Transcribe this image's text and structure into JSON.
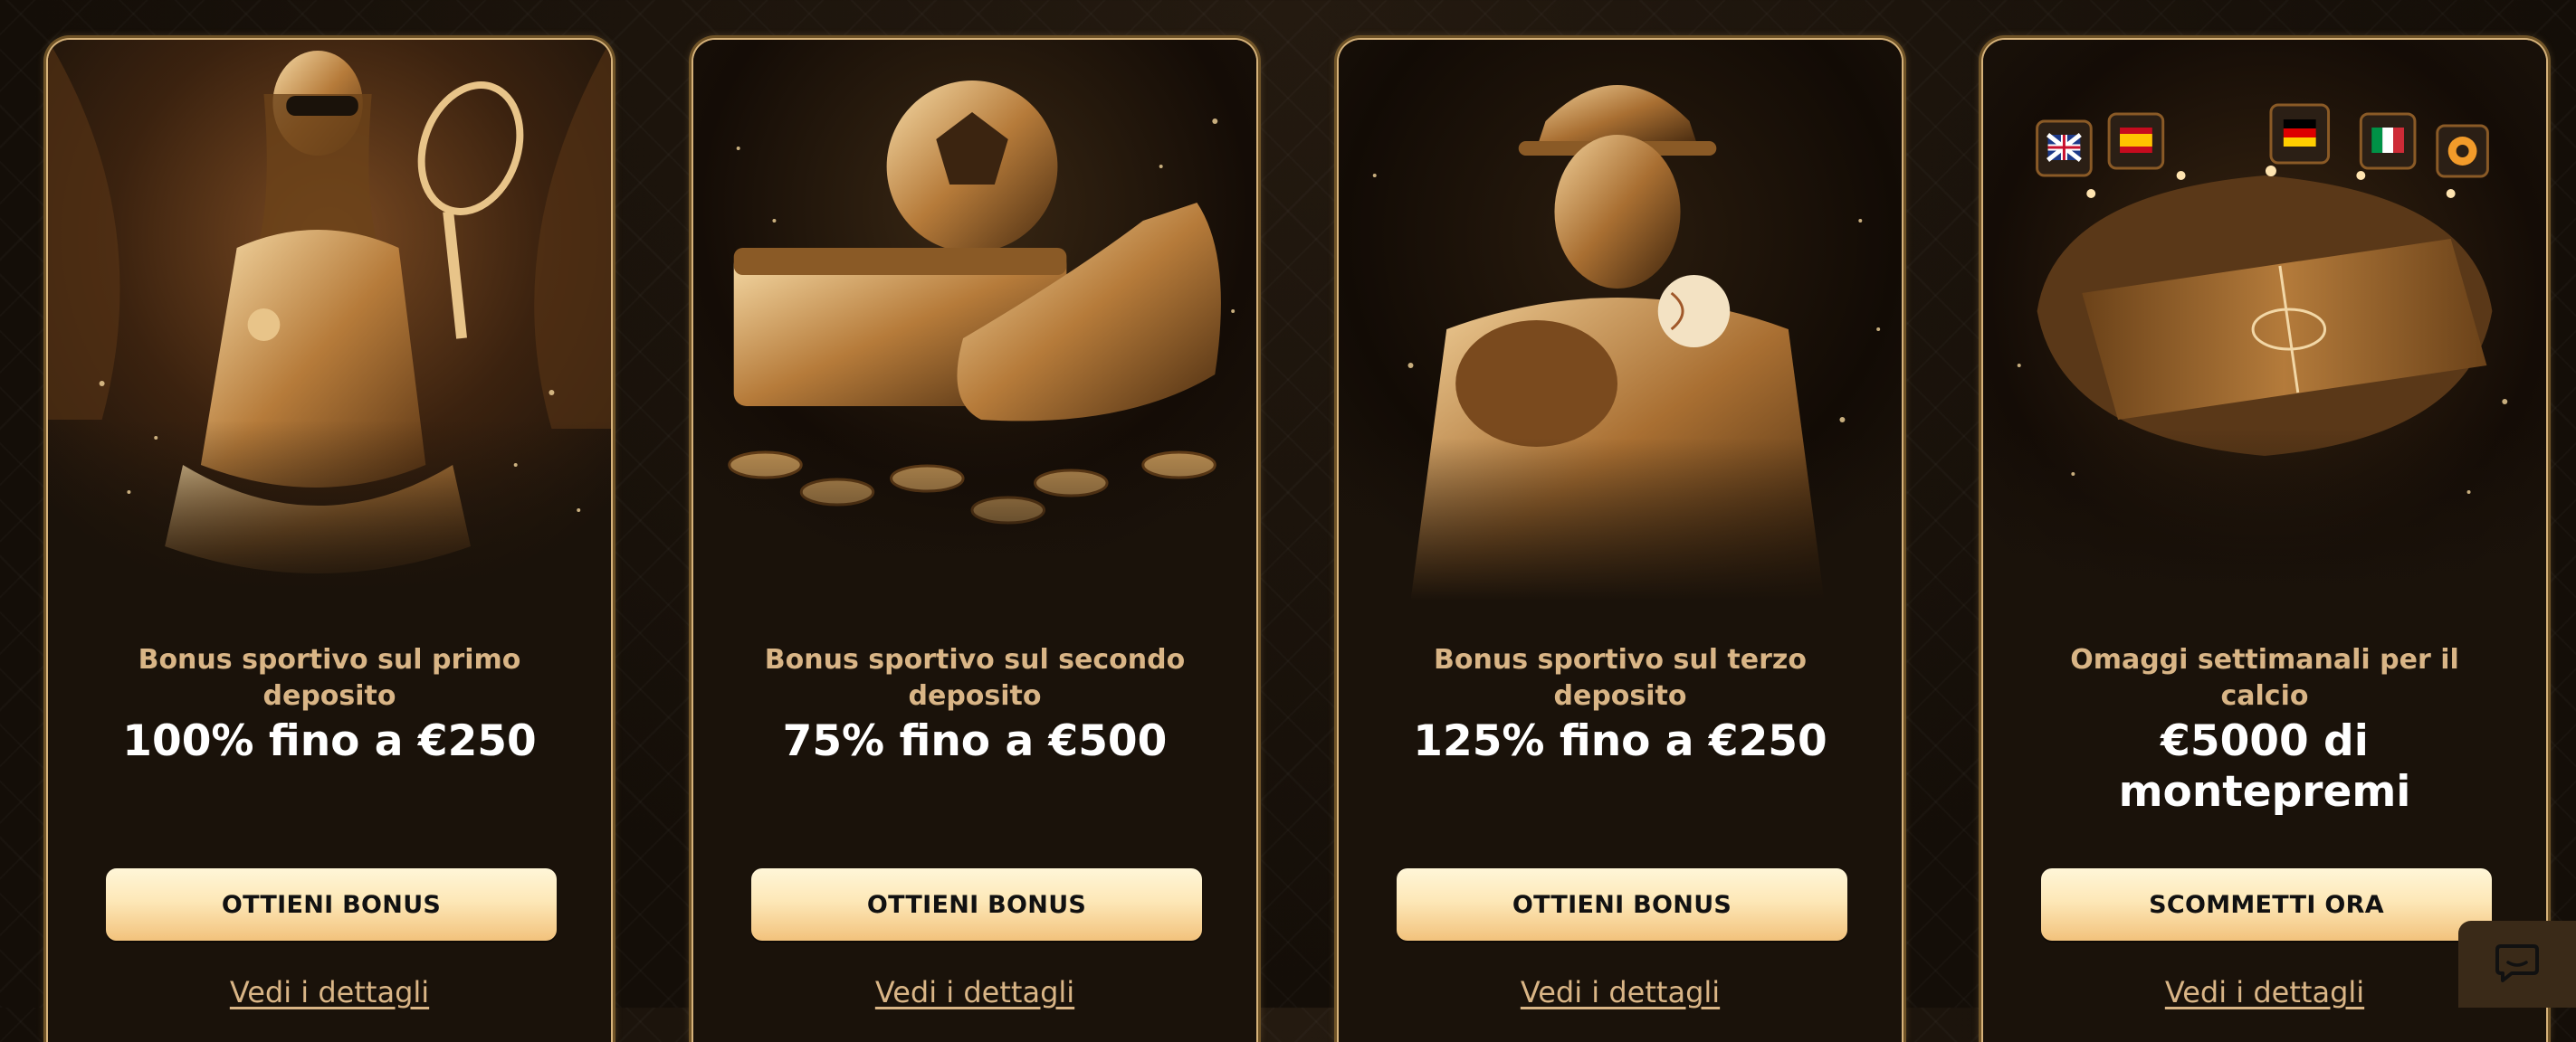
{
  "promos": [
    {
      "subtitle": "Bonus sportivo sul primo deposito",
      "title": "100% fino a €250",
      "button_label": "OTTIENI BONUS",
      "details_label": "Vedi i dettagli",
      "art_icon": "tennis-player-illustration"
    },
    {
      "subtitle": "Bonus sportivo sul secondo deposito",
      "title": "75% fino a €500",
      "button_label": "OTTIENI BONUS",
      "details_label": "Vedi i dettagli",
      "art_icon": "football-and-boot-illustration"
    },
    {
      "subtitle": "Bonus sportivo sul terzo deposito",
      "title": "125% fino a €250",
      "button_label": "OTTIENI BONUS",
      "details_label": "Vedi i dettagli",
      "art_icon": "baseball-player-illustration"
    },
    {
      "subtitle": "Omaggi settimanali per il calcio",
      "title": "€5000 di montepremi",
      "button_label": "SCOMMETTI ORA",
      "details_label": "Vedi i dettagli",
      "art_icon": "football-stadium-illustration",
      "flags": [
        "uk-flag-icon",
        "spain-flag-icon",
        "germany-flag-icon",
        "italy-flag-icon",
        "league-badge-icon"
      ]
    }
  ],
  "chat": {
    "icon": "chat-bubble-icon"
  },
  "colors": {
    "background": "#1b140c",
    "card_bg": "#1a120a",
    "card_border": "#d6b27a",
    "subtitle": "#d9b586",
    "title": "#ffffff",
    "button_top": "#fff6d8",
    "button_bottom": "#f2c27c"
  }
}
